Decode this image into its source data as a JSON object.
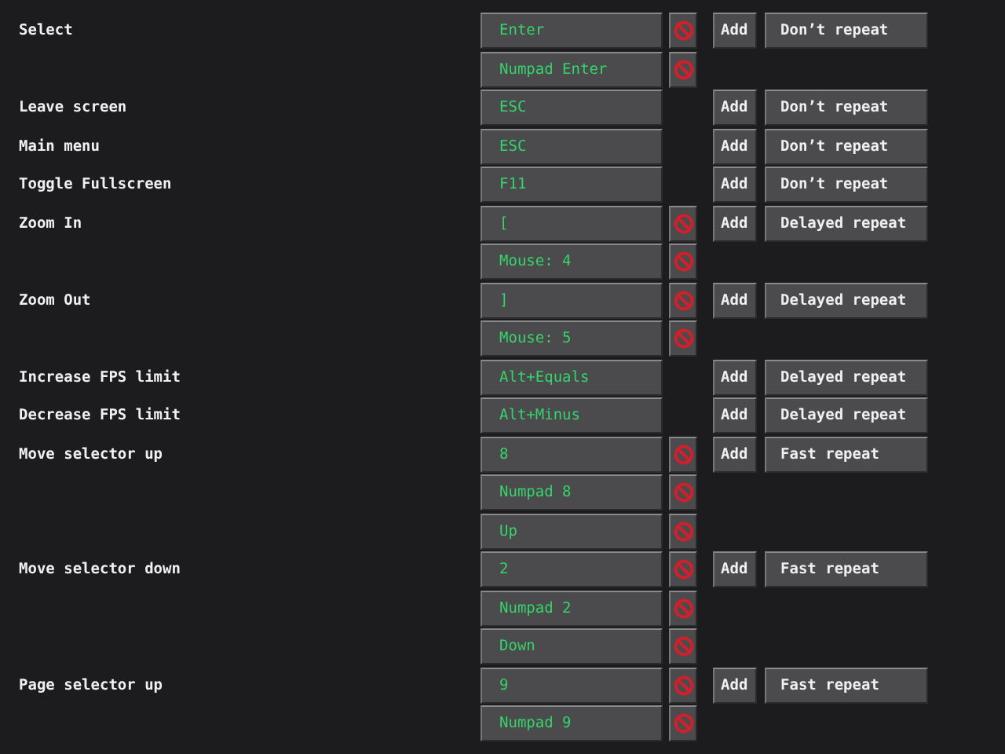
{
  "actions": [
    {
      "label": "Select",
      "bindings": [
        {
          "key": "Enter",
          "removable": true
        },
        {
          "key": "Numpad Enter",
          "removable": true
        }
      ],
      "add": "Add",
      "repeat": "Don’t repeat"
    },
    {
      "label": "Leave screen",
      "bindings": [
        {
          "key": "ESC",
          "removable": false
        }
      ],
      "add": "Add",
      "repeat": "Don’t repeat"
    },
    {
      "label": "Main menu",
      "bindings": [
        {
          "key": "ESC",
          "removable": false
        }
      ],
      "add": "Add",
      "repeat": "Don’t repeat"
    },
    {
      "label": "Toggle Fullscreen",
      "bindings": [
        {
          "key": "F11",
          "removable": false
        }
      ],
      "add": "Add",
      "repeat": "Don’t repeat"
    },
    {
      "label": "Zoom In",
      "bindings": [
        {
          "key": "[",
          "removable": true
        },
        {
          "key": "Mouse: 4",
          "removable": true
        }
      ],
      "add": "Add",
      "repeat": "Delayed repeat"
    },
    {
      "label": "Zoom Out",
      "bindings": [
        {
          "key": "]",
          "removable": true
        },
        {
          "key": "Mouse: 5",
          "removable": true
        }
      ],
      "add": "Add",
      "repeat": "Delayed repeat"
    },
    {
      "label": "Increase FPS limit",
      "bindings": [
        {
          "key": "Alt+Equals",
          "removable": false
        }
      ],
      "add": "Add",
      "repeat": "Delayed repeat"
    },
    {
      "label": "Decrease FPS limit",
      "bindings": [
        {
          "key": "Alt+Minus",
          "removable": false
        }
      ],
      "add": "Add",
      "repeat": "Delayed repeat"
    },
    {
      "label": "Move selector up",
      "bindings": [
        {
          "key": "8",
          "removable": true
        },
        {
          "key": "Numpad 8",
          "removable": true
        },
        {
          "key": "Up",
          "removable": true
        }
      ],
      "add": "Add",
      "repeat": "Fast repeat"
    },
    {
      "label": "Move selector down",
      "bindings": [
        {
          "key": "2",
          "removable": true
        },
        {
          "key": "Numpad 2",
          "removable": true
        },
        {
          "key": "Down",
          "removable": true
        }
      ],
      "add": "Add",
      "repeat": "Fast repeat"
    },
    {
      "label": "Page selector up",
      "bindings": [
        {
          "key": "9",
          "removable": true
        },
        {
          "key": "Numpad 9",
          "removable": true
        }
      ],
      "add": "Add",
      "repeat": "Fast repeat"
    }
  ]
}
